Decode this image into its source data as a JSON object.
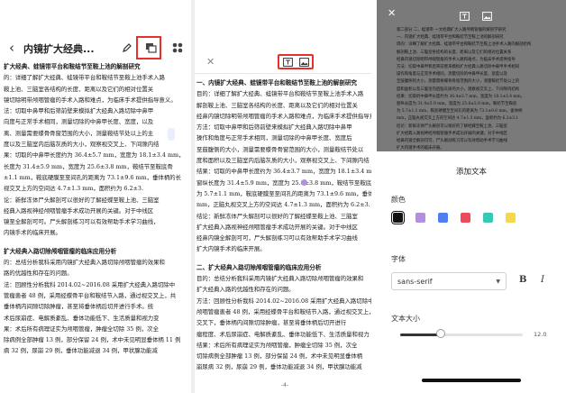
{
  "panel1": {
    "back_icon": "chevron-left-icon",
    "title": "内镜扩大经典...",
    "icons": [
      "pencil-icon",
      "text-image-icon",
      "grid-icon"
    ],
    "lines": [
      {
        "t": "扩大经典、蛙镜带平台和鞍结节至鞍上池的解剖研究",
        "h": true
      },
      {
        "t": "的：详细了解扩大经典、蛙镜带平台和鞍结节至鞍上池手术入路"
      },
      {
        "t": "鞍上池、三脑室各结构的长度、距离以及它们的相对位置关"
      },
      {
        "t": "镜切除明带颅咽管瘤的手术入路和难点，为临床手术提供指导意义。"
      },
      {
        "t": "法：切取中鼻甲和后筛前壁来模拟扩大经典入路切除中鼻甲"
      },
      {
        "t": "向度与正常手术相同，测量切除的中鼻甲长度、宽度，以及"
      },
      {
        "t": "离、测量需要蝶骨骨窗范围的大小，测量鞍结节处以上的主"
      },
      {
        "t": "度以及三脑室内后脑灰质的大小，观察视交叉上、下间隙内结"
      },
      {
        "t": "果：切取的中鼻甲长度约为 36.4±5.7 mm，宽度为 18.1±3.4 mm，"
      },
      {
        "t": "长度为 31.4±5.9 mm，宽度为 25.6±3.8 mm，鞍结节至鞍底骨"
      },
      {
        "t": "±1.1 mm，鞍底硬膜至至间孔的距离为 73.1±9.6 mm，垂体柄的长"
      },
      {
        "t": "视交叉上方的空间达 4.7±1.3 mm，面积约为 6.2±3."
      },
      {
        "t": "论：新鲜冻体尸头解剖可以很好的了解经蝶至鞍上池、三脑室"
      },
      {
        "t": "经典入路视神经颅咽管瘤手术成功开展的关键。对于中线区"
      },
      {
        "t": "镜至全解剖可可。尸头解剖练习可以有效帮助手术学习曲线，"
      },
      {
        "t": "内镜手术的临床开展。"
      },
      {
        "t": "",
        "gap": true
      },
      {
        "t": "扩大经典入路切除颅咽管瘤的临床应用分析",
        "h": true
      },
      {
        "t": "的：总结分析我科采用内镜扩大经典入路切除颅咽管瘤的效果和"
      },
      {
        "t": "路的优越性和存在的问题。"
      },
      {
        "t": "法：回顾性分析我科 2014.02~2016.08 采用扩大经典入路切除中"
      },
      {
        "t": "管瘤患者 48 例，采用经蝶骨平台和鞍结节入路，通过视交叉上，共"
      },
      {
        "t": "垂体柄内间隙切除肿瘤，甚至将垂体柄后切开进行手术。统"
      },
      {
        "t": "术后尿崩症、电解质紊乱、垂体功能低下、生活质量和视力变"
      },
      {
        "t": "果：术后所有病理证实为颅咽管瘤，肿瘤全切除 35 例，次全"
      },
      {
        "t": "除病例全部肿瘤 13 例，部分保留 24 例，术中未见明显垂体柄 11 例"
      },
      {
        "t": "病 32 例，尿崩 29 例，垂体功能减退 34 例，甲状腺功能减"
      }
    ]
  },
  "panel2": {
    "close_icon": "close-icon",
    "toolbar_icons": [
      "text-box-icon",
      "image-icon"
    ],
    "page_number": "-4-",
    "lines": [
      {
        "t": "一、内镜扩大经典、蛙镜带平台和鞍结节至鞍上池的解剖研究",
        "h": true
      },
      {
        "t": "目的：详细了解扩大经典、蛙镜带平台和鞍结节至鞍上池手术入路"
      },
      {
        "t": "解剖鞍上池、三脑室各结构的长度、距离以及它们的相对位置关"
      },
      {
        "t": "经鼻内镜切除明带颅咽管瘤的手术入路和难点，为临床手术提供指导意义。"
      },
      {
        "t": "方法：切取中鼻甲和后筛前壁来模拟扩大经典入路切除中鼻甲"
      },
      {
        "t": "操作和角度与正常手术相同，测量切除的中鼻甲长度、宽度后"
      },
      {
        "t": "至鼓腹侧的大小，测量需要蝶骨骨窗范围的大小，测量鞍结节处以"
      },
      {
        "t": "度和面积以及三脑室内后脑灰质的大小，观察视交叉上、下间隙内结"
      },
      {
        "t": "结果：切取的中鼻甲长度约为 36.4±3.7 mm，宽度为 18.1±3.4 mm"
      },
      {
        "t": "窗纵长度为 31.4±5.9 mm，宽度为 25.6±3.8 mm，鞍结节至鞍底"
      },
      {
        "t": "为 5.7±1.1 mm，鞍底硬膜至至间孔的距离为 73.1±9.6 mm，垂体柄的"
      },
      {
        "t": "mm，正脑丸视交叉上方的空间达 4.7±1.3 mm，面积约为 6.2±3."
      },
      {
        "t": "结论：新鲜冻体尸头解剖可以很好的了解经蝶至鞍上池、三脑室"
      },
      {
        "t": "扩大经典入路视神经颅咽管瘤手术成功开展的关键。对于中线区"
      },
      {
        "t": "经鼻内镜全解剖可可，尸头解剖练习可以有效帮助手术学习曲线"
      },
      {
        "t": "扩大内镜手术的临床开展。"
      },
      {
        "t": "",
        "gap": true
      },
      {
        "t": "二、扩大经典入路切除颅咽管瘤的临床应用分析",
        "h": true
      },
      {
        "t": "目的：总结分析我科采用内镜扩大经典入路切除颅咽管瘤的效果和"
      },
      {
        "t": "扩大经典入路的优越性和存在的问题。"
      },
      {
        "t": "方法：回顾性分析我科 2014.02~2016.08 采用扩大经典入路切除中"
      },
      {
        "t": "颅咽管瘤患者 48 例，采用经蝶骨平台和鞍结节入路，通过视交叉上，"
      },
      {
        "t": "交叉下，垂体柄内间隙切除肿瘤，甚至将垂体柄后切开进行"
      },
      {
        "t": "瘤程度、术后尿崩症、电解质紊乱、垂体功能低下、生活质量和视力"
      },
      {
        "t": "结果：术后所有病理证实为颅咽管瘤，肿瘤全切除 35 例，次全"
      },
      {
        "t": "切除病例全部肿瘤 13 例，部分保留 24 例，术中未见明显垂体柄"
      },
      {
        "t": "崩尿病 32 例，尿崩 29 例，垂体功能减退 34 例，甲状腺功能减"
      }
    ]
  },
  "panel3": {
    "close_icon": "close-icon",
    "toolbar_icons": [
      "text-box-icon",
      "image-icon"
    ],
    "doc_lines": [
      {
        "t": "第二部分 二、蛙镜带 一文经典扩大入路颅咽管瘤的解剖学研究",
        "h": true
      },
      {
        "t": "一、内镜扩大经典、蛙镜带平台和鞍结节至鞍上池的解剖研究",
        "h": true
      },
      {
        "t": "目的：详细了解扩大经典、蛙镜带平台和鞍结节至鞍上池手术入路的解剖结构"
      },
      {
        "t": "解剖鞍上池、三脑室各结构的长度、距离以及它们的相对位置关系"
      },
      {
        "t": "经鼻内镜切除明带颅咽管瘤的手术入路和难点，为临床手术提供指导"
      },
      {
        "t": "方法：切取中鼻甲和后筛前壁来模拟扩大经典入路切除中鼻甲手术相同"
      },
      {
        "t": "操作和角度与正常手术相同，测量切除的中鼻甲长度、宽度以及"
      },
      {
        "t": "至鼓腹侧的大小，测量需要蝶骨骨窗范围的大小，测量鞍结节处以上的"
      },
      {
        "t": "度和面积以及三脑室内后脑灰质的大小，观察视交叉上、下间隙内结构"
      },
      {
        "t": "结果：切取的中鼻甲长度约为 36.4±3.7 mm，宽度为 18.1±3.4 mm，"
      },
      {
        "t": "窗纵长度为 31.4±5.9 mm，宽度为 25.6±3.8 mm，鞍结节至鞍底"
      },
      {
        "t": "为 5.7±1.1 mm，鞍底硬膜至至间孔的距离为 73.1±9.6 mm，垂体柄"
      },
      {
        "t": "mm，正脑丸视交叉上方的空间达 4.7±1.3 mm，面积约为 6.2±3.1"
      },
      {
        "t": "结论：新鲜冻体尸头解剖可以很好的了解经蝶至鞍上池、三脑室"
      },
      {
        "t": "扩大经典入路视神经颅咽管瘤手术成功开展的关键。对于中线区"
      },
      {
        "t": "经鼻内镜全解剖可可，尸头解剖练习可以有效帮助手术学习曲线"
      },
      {
        "t": "扩大内镜手术的临床开展。"
      }
    ],
    "sheet": {
      "title": "添加文本",
      "color_label": "颜色",
      "colors": [
        {
          "name": "color-swatch-black",
          "hex": "#111111",
          "selected": true
        },
        {
          "name": "color-swatch-purple",
          "hex": "#b48ee0"
        },
        {
          "name": "color-swatch-blue",
          "hex": "#4f7df2"
        },
        {
          "name": "color-swatch-red",
          "hex": "#ef4a5c"
        },
        {
          "name": "color-swatch-teal",
          "hex": "#37c9b4"
        },
        {
          "name": "color-swatch-yellow",
          "hex": "#f5d94a"
        }
      ],
      "font_label": "字体",
      "font_value": "sans-serif",
      "bold_label": "B",
      "italic_label": "I",
      "size_label": "文本大小",
      "size_value": "12.0",
      "size_fraction": 0.33
    }
  }
}
